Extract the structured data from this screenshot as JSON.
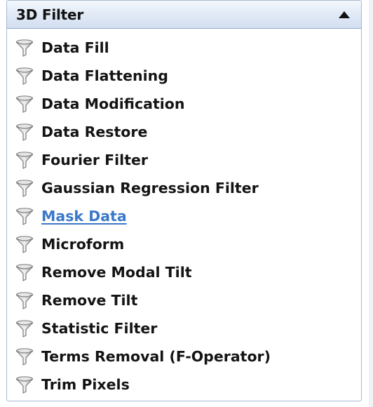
{
  "panel": {
    "title": "3D Filter",
    "collapse_icon": "caret-up-icon",
    "item_icon": "funnel-filter-icon",
    "link_color": "#3a78c9",
    "items": [
      {
        "label": "Data Fill"
      },
      {
        "label": "Data Flattening"
      },
      {
        "label": "Data Modification"
      },
      {
        "label": "Data Restore"
      },
      {
        "label": "Fourier Filter"
      },
      {
        "label": "Gaussian Regression Filter"
      },
      {
        "label": "Mask Data",
        "hovered": true
      },
      {
        "label": "Microform"
      },
      {
        "label": "Remove Modal Tilt"
      },
      {
        "label": "Remove Tilt"
      },
      {
        "label": "Statistic Filter"
      },
      {
        "label": "Terms Removal (F-Operator)"
      },
      {
        "label": "Trim Pixels"
      }
    ]
  }
}
